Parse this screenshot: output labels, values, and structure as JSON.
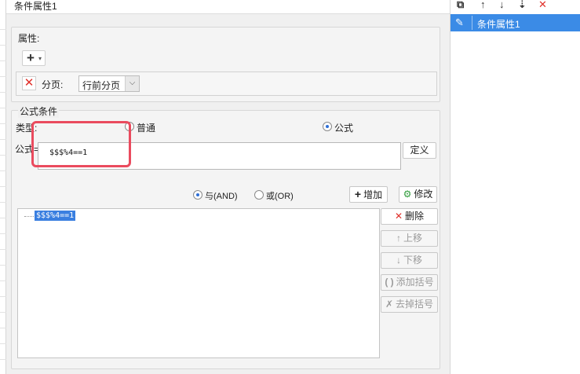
{
  "dialog": {
    "title": "条件属性1"
  },
  "attributes": {
    "section_label": "属性:",
    "add_symbol": "+",
    "caret_symbol": "▾",
    "delete_symbol": "✕",
    "page_label": "分页:",
    "page_select_value": "行前分页",
    "dropdown_symbol": "⌵"
  },
  "formula_condition": {
    "section_label": "公式条件",
    "type_label": "类型:",
    "type_options": [
      {
        "label": "普通",
        "checked": false
      },
      {
        "label": "公式",
        "checked": true
      }
    ],
    "formula_label": "公式=",
    "formula_value": "$$$%4==1",
    "define_button": "定义",
    "logic_options": [
      {
        "label": "与(AND)",
        "checked": true
      },
      {
        "label": "或(OR)",
        "checked": false
      }
    ],
    "add_button": "增加",
    "modify_button": "修改",
    "conditions": [
      "$$$%4==1"
    ],
    "side_buttons": [
      {
        "label": "删除",
        "icon": "✕",
        "enabled": true
      },
      {
        "label": "上移",
        "icon": "↑",
        "enabled": false
      },
      {
        "label": "下移",
        "icon": "↓",
        "enabled": false
      },
      {
        "label": "添加括号",
        "icon": "( )",
        "enabled": false
      },
      {
        "label": "去掉括号",
        "icon": "✗",
        "enabled": false
      }
    ]
  },
  "right_panel": {
    "toolbar": [
      {
        "name": "copy-icon",
        "glyph": "⧉"
      },
      {
        "name": "move-up-icon",
        "glyph": "↑"
      },
      {
        "name": "move-down-icon",
        "glyph": "↓"
      },
      {
        "name": "sort-icon",
        "glyph": "⇣"
      },
      {
        "name": "delete-icon",
        "glyph": "✕"
      }
    ],
    "items": [
      {
        "label": "条件属性1",
        "selected": true
      }
    ]
  },
  "colors": {
    "accent": "#3b8be6",
    "highlight_frame": "#ea4b5e",
    "delete_red": "#e0302a",
    "selection": "#3a7fe0"
  }
}
